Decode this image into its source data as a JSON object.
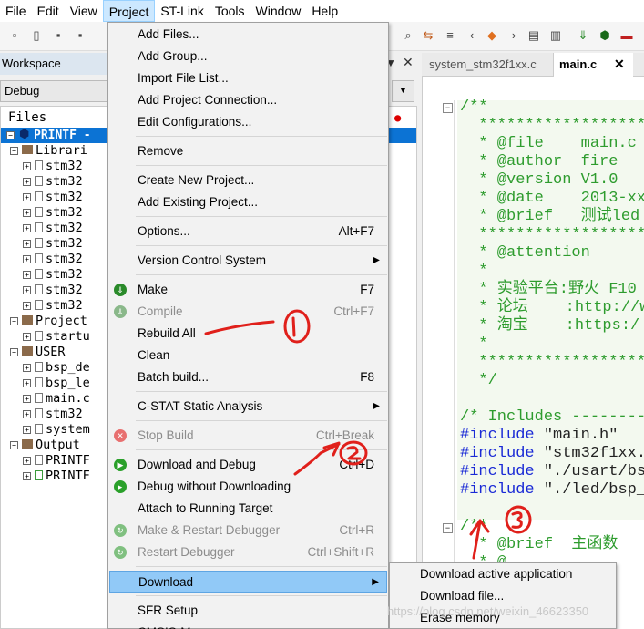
{
  "menubar": {
    "items": [
      "File",
      "Edit",
      "View",
      "Project",
      "ST-Link",
      "Tools",
      "Window",
      "Help"
    ],
    "active": "Project"
  },
  "workspace": {
    "title": "Workspace",
    "config": "Debug",
    "files_header": "Files",
    "project": "PRINTF -",
    "tree": [
      {
        "label": "Librari",
        "kind": "folder"
      },
      {
        "label": "stm32",
        "kind": "file"
      },
      {
        "label": "stm32",
        "kind": "file"
      },
      {
        "label": "stm32",
        "kind": "file"
      },
      {
        "label": "stm32",
        "kind": "file"
      },
      {
        "label": "stm32",
        "kind": "file"
      },
      {
        "label": "stm32",
        "kind": "file"
      },
      {
        "label": "stm32",
        "kind": "file"
      },
      {
        "label": "stm32",
        "kind": "file"
      },
      {
        "label": "stm32",
        "kind": "file"
      },
      {
        "label": "stm32",
        "kind": "file"
      },
      {
        "label": "Project",
        "kind": "folder"
      },
      {
        "label": "startu",
        "kind": "file"
      },
      {
        "label": "USER",
        "kind": "folder"
      },
      {
        "label": "bsp_de",
        "kind": "file"
      },
      {
        "label": "bsp_le",
        "kind": "file"
      },
      {
        "label": "main.c",
        "kind": "file"
      },
      {
        "label": "stm32",
        "kind": "file"
      },
      {
        "label": "system",
        "kind": "file"
      },
      {
        "label": "Output",
        "kind": "folder"
      },
      {
        "label": "PRINTF",
        "kind": "file"
      },
      {
        "label": "PRINTF",
        "kind": "file"
      }
    ]
  },
  "editor": {
    "tabs": [
      "system_stm32f1xx.c",
      "main.c"
    ],
    "active_tab": "main.c",
    "lines": [
      {
        "cls": "cm",
        "text": "/**"
      },
      {
        "cls": "cm",
        "text": "  ********************"
      },
      {
        "cls": "cm",
        "text": "  * @file    main.c"
      },
      {
        "cls": "cm",
        "text": "  * @author  fire"
      },
      {
        "cls": "cm",
        "text": "  * @version V1.0"
      },
      {
        "cls": "cm",
        "text": "  * @date    2013-xx-"
      },
      {
        "cls": "cm",
        "text": "  * @brief   测试led"
      },
      {
        "cls": "cm",
        "text": "  ********************"
      },
      {
        "cls": "cm",
        "text": "  * @attention"
      },
      {
        "cls": "cm",
        "text": "  *"
      },
      {
        "cls": "cm",
        "text": "  * 实验平台:野火 F10"
      },
      {
        "cls": "cm",
        "text": "  * 论坛    :http://w"
      },
      {
        "cls": "cm",
        "text": "  * 淘宝    :https:/"
      },
      {
        "cls": "cm",
        "text": "  *"
      },
      {
        "cls": "cm",
        "text": "  ********************"
      },
      {
        "cls": "cm",
        "text": "  */"
      },
      {
        "cls": "st",
        "text": ""
      },
      {
        "cls": "cm",
        "text": "/* Includes ---------"
      },
      {
        "cls": "kw",
        "text": "#include",
        "rest": " \"main.h\""
      },
      {
        "cls": "kw",
        "text": "#include",
        "rest": " \"stm32f1xx.h"
      },
      {
        "cls": "kw",
        "text": "#include",
        "rest": " \"./usart/bsp"
      },
      {
        "cls": "kw",
        "text": "#include",
        "rest": " \"./led/bsp_"
      },
      {
        "cls": "st",
        "text": ""
      },
      {
        "cls": "cm",
        "text": "/**"
      },
      {
        "cls": "cm",
        "text": "  * @brief  主函数"
      },
      {
        "cls": "cm",
        "text": "  * @"
      }
    ]
  },
  "project_menu": {
    "items": [
      {
        "label": "Add Files...",
        "shortcut": "",
        "disabled": false
      },
      {
        "label": "Add Group...",
        "shortcut": "",
        "disabled": false
      },
      {
        "label": "Import File List...",
        "shortcut": "",
        "disabled": false
      },
      {
        "label": "Add Project Connection...",
        "shortcut": "",
        "disabled": false
      },
      {
        "label": "Edit Configurations...",
        "shortcut": "",
        "disabled": false
      },
      {
        "label": "Remove",
        "shortcut": "",
        "disabled": false
      },
      {
        "label": "Create New Project...",
        "shortcut": "",
        "disabled": false
      },
      {
        "label": "Add Existing Project...",
        "shortcut": "",
        "disabled": false
      },
      {
        "label": "Options...",
        "shortcut": "Alt+F7",
        "disabled": false
      },
      {
        "label": "Version Control System",
        "shortcut": "",
        "disabled": false,
        "submenu": true
      },
      {
        "label": "Make",
        "shortcut": "F7",
        "disabled": false
      },
      {
        "label": "Compile",
        "shortcut": "Ctrl+F7",
        "disabled": true
      },
      {
        "label": "Rebuild All",
        "shortcut": "",
        "disabled": false
      },
      {
        "label": "Clean",
        "shortcut": "",
        "disabled": false
      },
      {
        "label": "Batch build...",
        "shortcut": "F8",
        "disabled": false
      },
      {
        "label": "C-STAT Static Analysis",
        "shortcut": "",
        "disabled": false,
        "submenu": true
      },
      {
        "label": "Stop Build",
        "shortcut": "Ctrl+Break",
        "disabled": true
      },
      {
        "label": "Download and Debug",
        "shortcut": "Ctrl+D",
        "disabled": false
      },
      {
        "label": "Debug without Downloading",
        "shortcut": "",
        "disabled": false
      },
      {
        "label": "Attach to Running Target",
        "shortcut": "",
        "disabled": false
      },
      {
        "label": "Make & Restart Debugger",
        "shortcut": "Ctrl+R",
        "disabled": true
      },
      {
        "label": "Restart Debugger",
        "shortcut": "Ctrl+Shift+R",
        "disabled": true
      },
      {
        "label": "Download",
        "shortcut": "",
        "disabled": false,
        "submenu": true,
        "highlight": true
      },
      {
        "label": "SFR Setup",
        "shortcut": "",
        "disabled": false
      },
      {
        "label": "CMSIS-M",
        "shortcut": "",
        "disabled": false
      }
    ]
  },
  "download_submenu": {
    "items": [
      "Download active application",
      "Download file...",
      "Erase memory"
    ]
  },
  "watermark": "https://blog.csdn.net/weixin_46623350",
  "colors": {
    "accent": "#0c73d4",
    "highlight": "#91c9f7",
    "annotation": "#e0201b",
    "comment": "#2e9c2e",
    "keyword": "#1a2ad6"
  }
}
